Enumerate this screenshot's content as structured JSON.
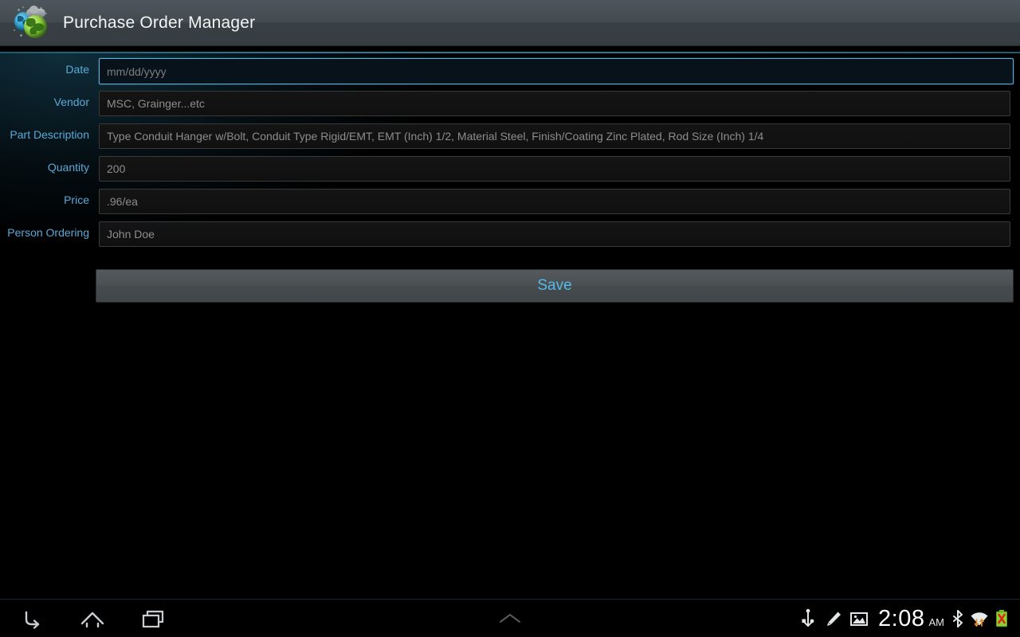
{
  "app": {
    "title": "Purchase Order Manager",
    "icon_name": "globe-app-icon",
    "accent_color": "#2d93ae",
    "label_color": "#5aa9d6"
  },
  "form": {
    "fields": [
      {
        "label": "Date",
        "value": "mm/dd/yyyy",
        "focused": true,
        "name": "date"
      },
      {
        "label": "Vendor",
        "value": "MSC, Grainger...etc",
        "focused": false,
        "name": "vendor"
      },
      {
        "label": "Part Description",
        "value": "Type  Conduit Hanger w/Bolt, Conduit Type  Rigid/EMT, EMT (Inch)  1/2, Material  Steel, Finish/Coating  Zinc Plated, Rod Size (Inch)  1/4",
        "focused": false,
        "name": "part-description"
      },
      {
        "label": "Quantity",
        "value": "200",
        "focused": false,
        "name": "quantity"
      },
      {
        "label": "Price",
        "value": ".96/ea",
        "focused": false,
        "name": "price"
      },
      {
        "label": "Person Ordering",
        "value": "John Doe",
        "focused": false,
        "name": "person-ordering"
      }
    ],
    "save_label": "Save",
    "save_text_color": "#56b9e6"
  },
  "system_bar": {
    "nav": [
      {
        "name": "back-icon",
        "label": "Back"
      },
      {
        "name": "home-icon",
        "label": "Home"
      },
      {
        "name": "recent-apps-icon",
        "label": "Recent apps"
      }
    ],
    "handle_icon": "chevron-up-icon",
    "tray": [
      {
        "name": "usb-icon",
        "label": "USB connected"
      },
      {
        "name": "pencil-icon",
        "label": "Edit"
      },
      {
        "name": "screenshot-icon",
        "label": "Screenshot"
      }
    ],
    "clock": {
      "time": "2:08",
      "ampm": "AM"
    },
    "status": [
      {
        "name": "bluetooth-icon",
        "label": "Bluetooth"
      },
      {
        "name": "wifi-icon",
        "label": "Wi-Fi"
      },
      {
        "name": "battery-icon",
        "label": "Battery unknown"
      }
    ]
  }
}
